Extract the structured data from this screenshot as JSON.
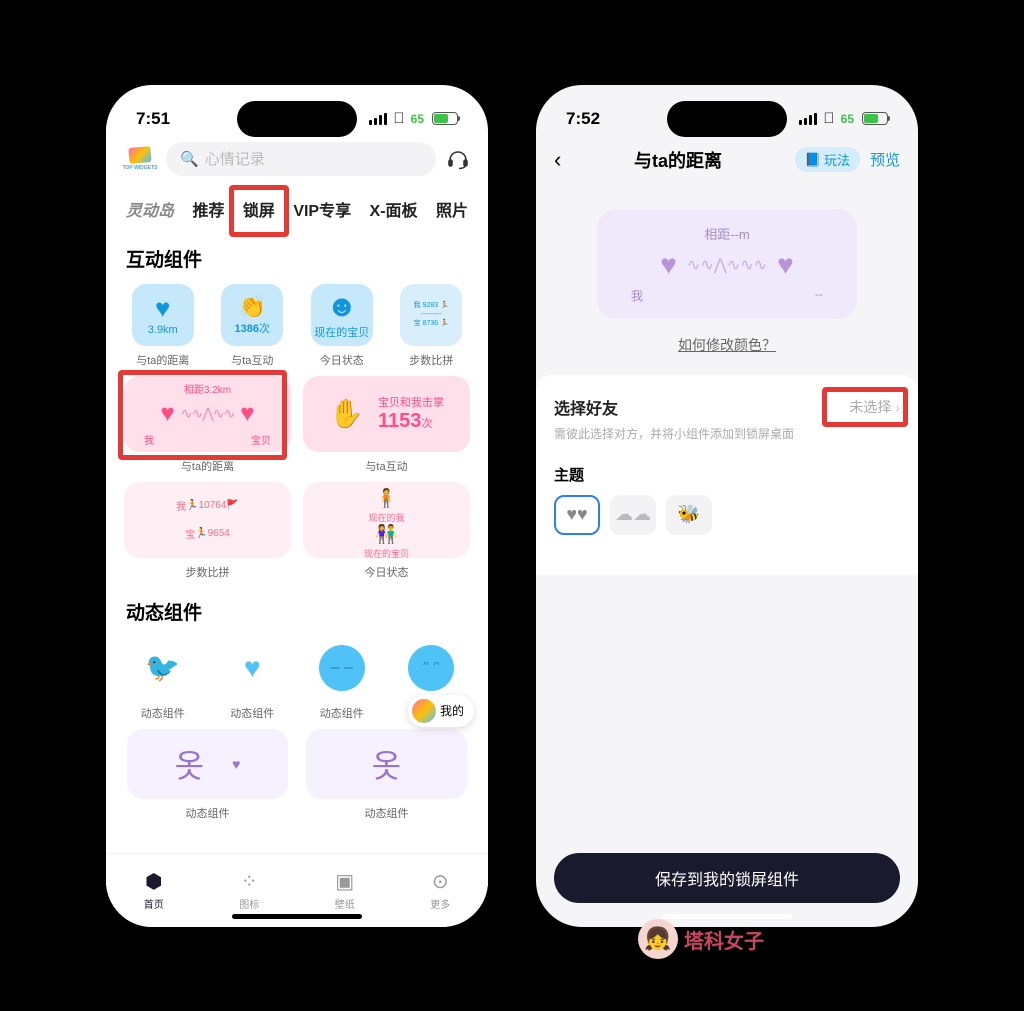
{
  "left": {
    "status": {
      "time": "7:51",
      "battery": "65"
    },
    "app_logo_text": "TOP WIDGETS",
    "search_placeholder": "心情记录",
    "tabs": {
      "dynamic_island": "灵动岛",
      "recommend": "推荐",
      "lock_screen": "锁屏",
      "vip": "VIP专享",
      "x_panel": "X-面板",
      "photo": "照片"
    },
    "sections": {
      "interactive": "互动组件",
      "dynamic": "动态组件"
    },
    "widgets_row1": {
      "distance": {
        "value": "3.9km",
        "label": "与ta的距离"
      },
      "interact": {
        "value": "1386",
        "unit": "次",
        "label": "与ta互动"
      },
      "status": {
        "text": "现在的宝贝",
        "label": "今日状态"
      },
      "steps": {
        "me": "我",
        "me_val": "9283",
        "baby": "宝",
        "baby_val": "8736",
        "label": "步数比拼"
      }
    },
    "wide1": {
      "distance": {
        "top": "相距3.2km",
        "left": "我",
        "right": "宝贝",
        "label": "与ta的距离"
      },
      "clap": {
        "text1": "宝贝和我击掌",
        "value": "1153",
        "unit": "次",
        "label": "与ta互动"
      }
    },
    "wide2": {
      "steps": {
        "me": "我",
        "me_val": "10764",
        "baby": "宝",
        "baby_val": "9654",
        "label": "步数比拼"
      },
      "status": {
        "me": "现在的我",
        "baby": "现在的宝贝",
        "label": "今日状态"
      }
    },
    "dynamic_label": "动态组件",
    "float_my": "我的",
    "nav": {
      "home": "首页",
      "icons": "图标",
      "wallpaper": "壁纸",
      "more": "更多"
    }
  },
  "right": {
    "status": {
      "time": "7:52",
      "battery": "65"
    },
    "header": {
      "title": "与ta的距离",
      "play": "玩法",
      "preview": "预览"
    },
    "preview": {
      "title": "相距--m",
      "left": "我",
      "right": "--"
    },
    "color_link": "如何修改颜色？",
    "friend": {
      "label": "选择好友",
      "value": "未选择",
      "hint": "需彼此选择对方，并将小组件添加到锁屏桌面"
    },
    "theme_label": "主题",
    "save": "保存到我的锁屏组件"
  },
  "watermark": "塔科女子"
}
